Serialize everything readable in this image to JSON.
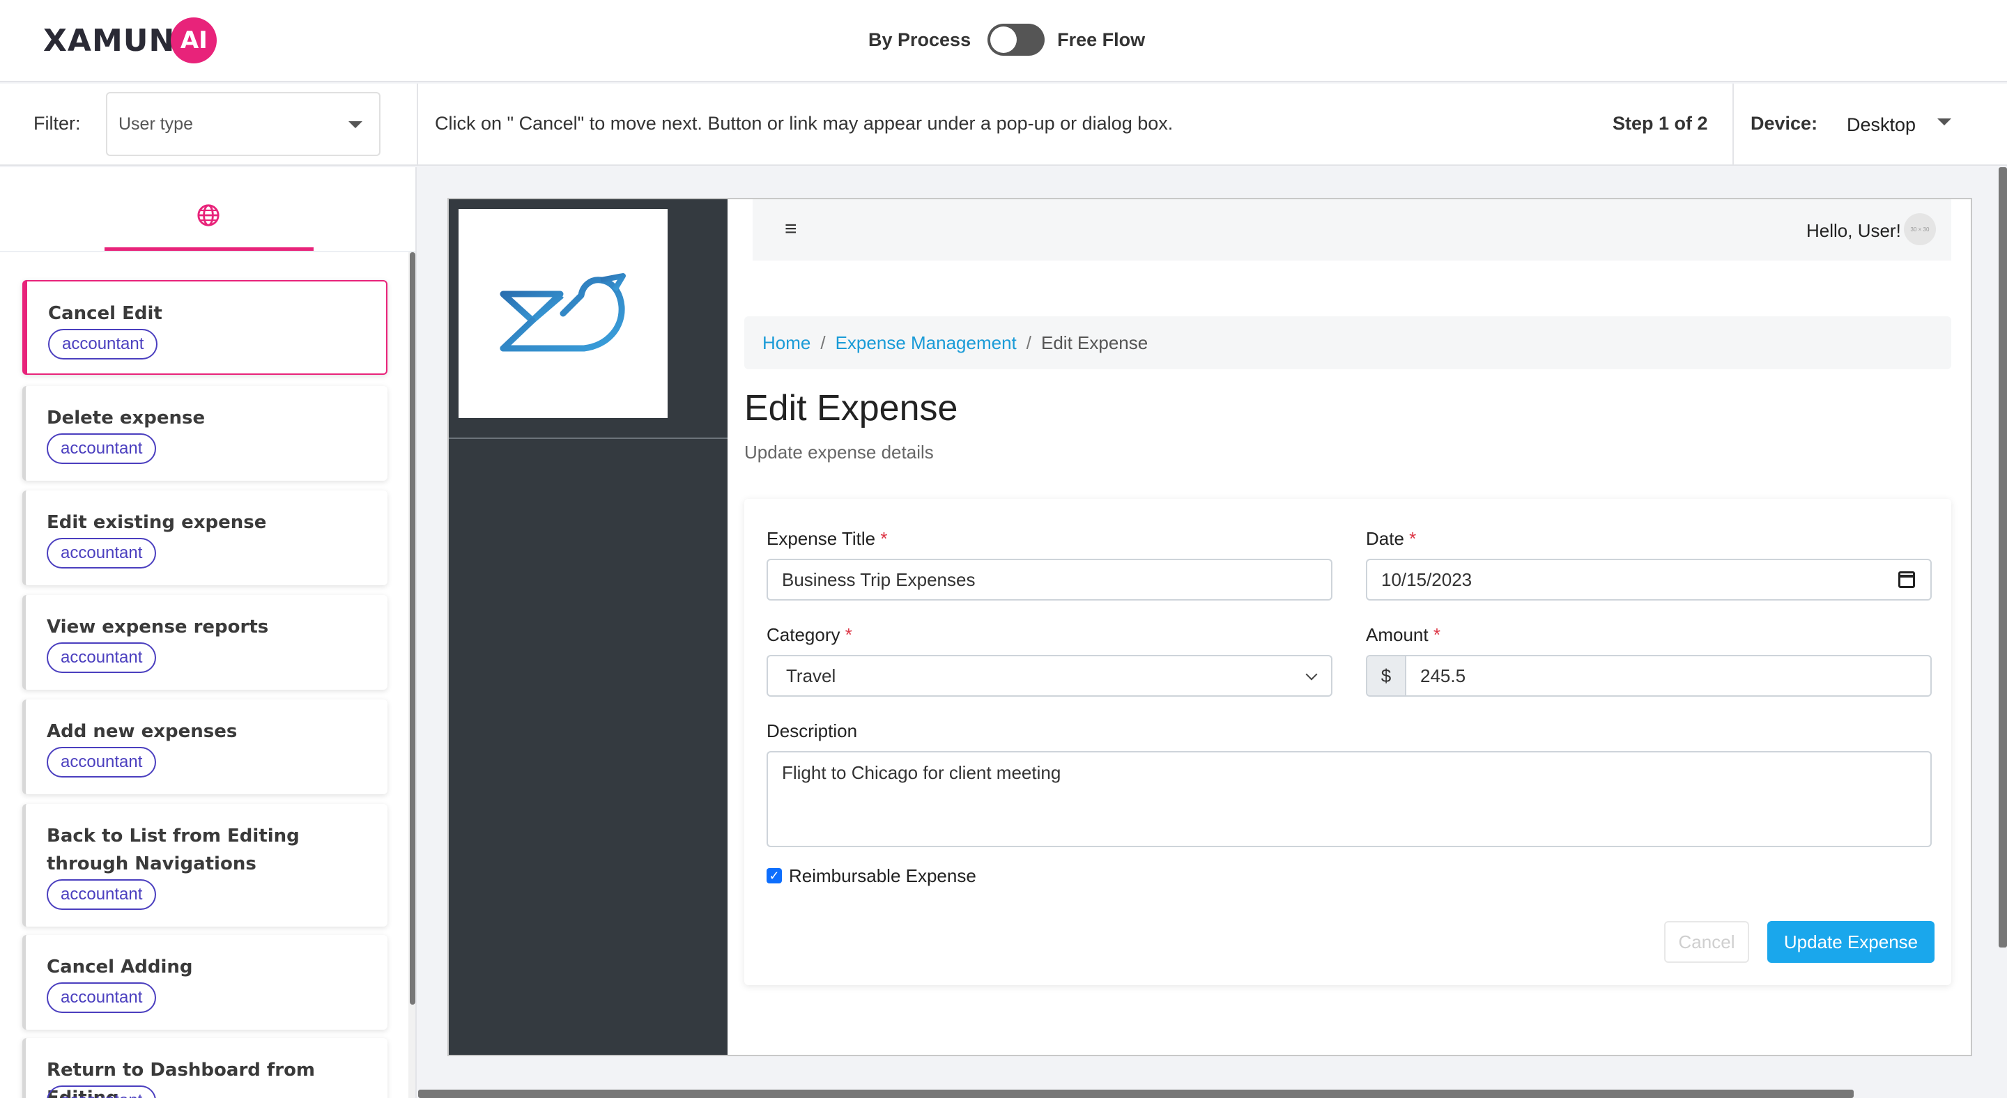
{
  "header": {
    "logo_text": "XAMUN",
    "logo_ai": "AI",
    "mode_left": "By Process",
    "mode_right": "Free Flow"
  },
  "subbar": {
    "filter_label": "Filter:",
    "filter_value": "User type",
    "instruction": "Click on \" Cancel\" to move next. Button or link may appear under a pop-up or dialog box.",
    "step": "Step 1 of 2",
    "device_label": "Device:",
    "device_value": "Desktop"
  },
  "sidebar": {
    "tab_icon": "globe-icon",
    "cards": [
      {
        "title": "Cancel Edit",
        "badge": "accountant"
      },
      {
        "title": "Delete expense",
        "badge": "accountant"
      },
      {
        "title": "Edit existing expense",
        "badge": "accountant"
      },
      {
        "title": "View expense reports",
        "badge": "accountant"
      },
      {
        "title": "Add new expenses",
        "badge": "accountant"
      },
      {
        "title": "Back to List from Editing through Navigations",
        "badge": "accountant"
      },
      {
        "title": "Cancel Adding",
        "badge": "accountant"
      },
      {
        "title": "Return to Dashboard from Editing",
        "badge": "accountant"
      }
    ]
  },
  "app": {
    "hamburger": "≡",
    "greeting": "Hello, User!",
    "avatar_text": "30 × 30",
    "breadcrumb": {
      "home": "Home",
      "section": "Expense Management",
      "current": "Edit Expense",
      "separator": "/"
    },
    "page_title": "Edit Expense",
    "page_subtitle": "Update expense details",
    "form": {
      "title_label": "Expense Title",
      "title_value": "Business Trip Expenses",
      "date_label": "Date",
      "date_value": "10/15/2023",
      "category_label": "Category",
      "category_value": "Travel",
      "amount_label": "Amount",
      "amount_prefix": "$",
      "amount_value": "245.5",
      "description_label": "Description",
      "description_value": "Flight to Chicago for client meeting",
      "reimbursable_label": "Reimbursable Expense",
      "reimbursable_checked": true,
      "required_mark": "*",
      "cancel_label": "Cancel",
      "update_label": "Update Expense"
    }
  },
  "colors": {
    "accent": "#e8237a",
    "badge": "#4b3fbf",
    "primary": "#1aa7ec",
    "link": "#1a9bd7",
    "app_sidebar": "#343a40"
  }
}
